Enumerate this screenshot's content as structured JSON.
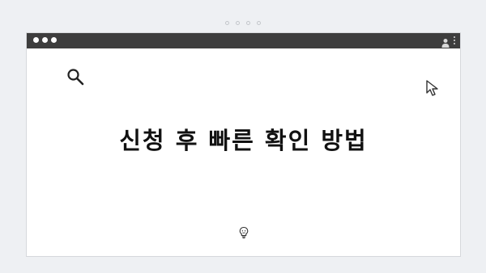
{
  "pager": {
    "dot_count": 4
  },
  "window": {
    "controls": [
      "window-dot",
      "window-dot",
      "window-dot"
    ],
    "icons": [
      "user-icon",
      "kebab-menu-icon"
    ]
  },
  "content": {
    "headline": "신청 후 빠른 확인 방법",
    "icons": [
      "search-icon",
      "cursor-icon",
      "lightbulb-icon"
    ]
  },
  "colors": {
    "page_background": "#eef0f3",
    "titlebar": "#3d3d3d",
    "card_background": "#ffffff",
    "headline_text": "#111111"
  }
}
